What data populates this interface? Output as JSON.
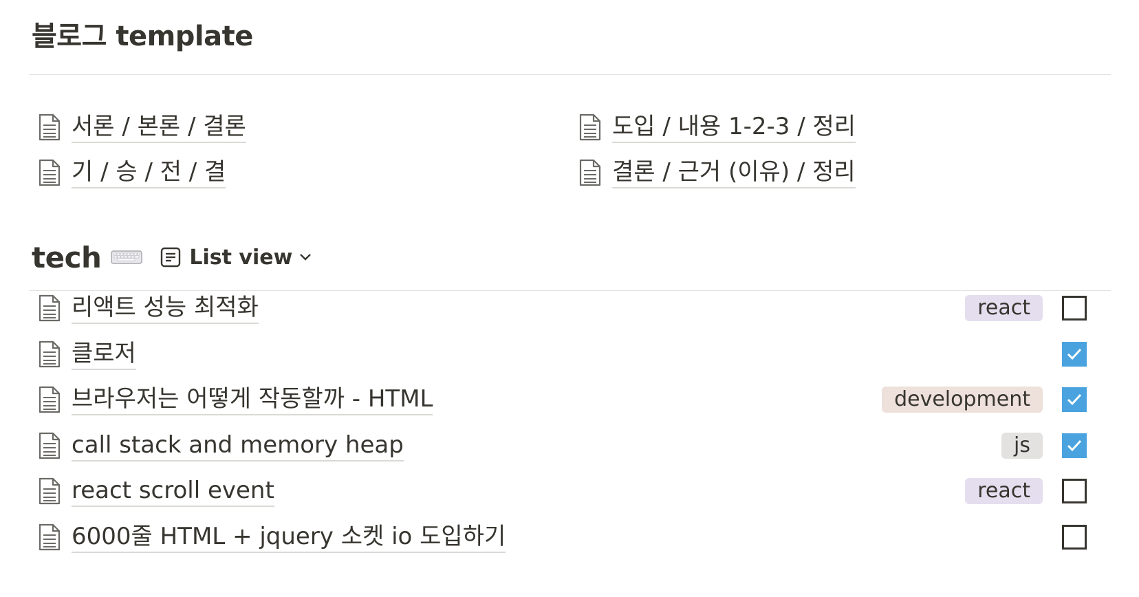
{
  "page_title": "블로그 template",
  "template_links": [
    {
      "label": "서론 / 본론 / 결론",
      "icon": "document-icon"
    },
    {
      "label": "도입 / 내용 1-2-3 / 정리",
      "icon": "document-icon"
    },
    {
      "label": "기 / 승 / 전 / 결",
      "icon": "document-icon"
    },
    {
      "label": "결론 / 근거 (이유) / 정리",
      "icon": "document-icon"
    }
  ],
  "database": {
    "title": "tech",
    "title_emoji": "keyboard-icon",
    "view_label": "List view",
    "view_icon": "list-view-icon",
    "items": [
      {
        "title": "리액트 성능 최적화",
        "tag": "react",
        "tag_color": "#e4deef",
        "checked": false
      },
      {
        "title": "클로저",
        "tag": "",
        "tag_color": "",
        "checked": true
      },
      {
        "title": "브라우저는 어떻게 작동할까 - HTML",
        "tag": "development",
        "tag_color": "#eee0da",
        "checked": true
      },
      {
        "title": "call stack and memory heap",
        "tag": "js",
        "tag_color": "#e3e2e0",
        "checked": true
      },
      {
        "title": "react scroll event",
        "tag": "react",
        "tag_color": "#e4deef",
        "checked": false
      },
      {
        "title": "6000줄 HTML + jquery 소켓 io 도입하기",
        "tag": "",
        "tag_color": "",
        "checked": false
      }
    ]
  },
  "colors": {
    "text": "#37352f",
    "divider": "#e3e2df",
    "checkbox_checked": "#4aa3df"
  }
}
